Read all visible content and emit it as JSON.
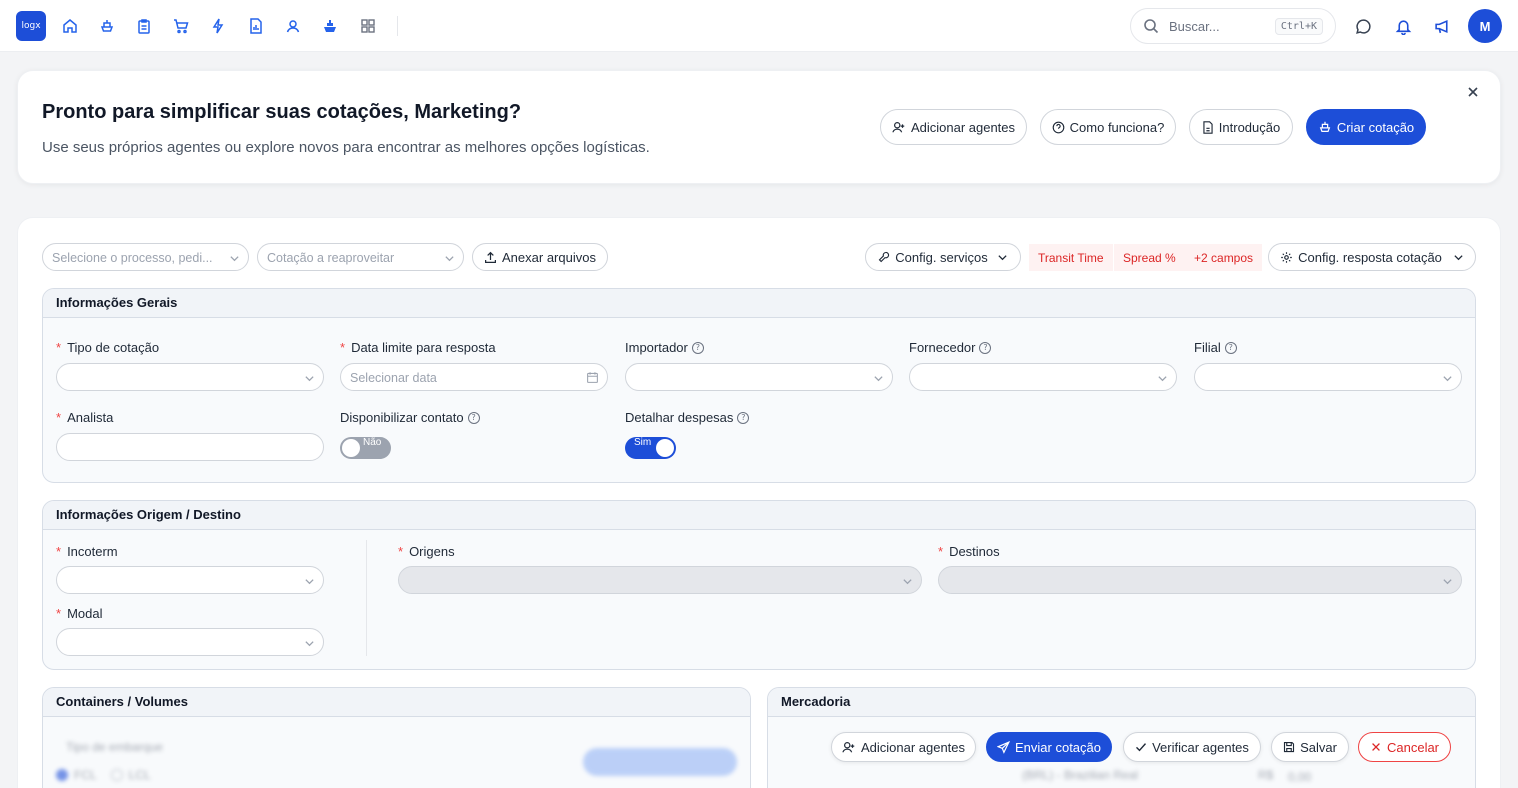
{
  "topbar": {
    "logo_text": "logx",
    "nav_icons": [
      "home-icon",
      "ship-icon",
      "clipboard-icon",
      "cart-icon",
      "bolt-icon",
      "document-chart-icon",
      "user-badge-icon",
      "vessel-icon",
      "grid-icon"
    ],
    "search_placeholder": "Buscar...",
    "search_shortcut": "Ctrl+K",
    "avatar_initial": "M"
  },
  "banner": {
    "title": "Pronto para simplificar suas cotações, Marketing?",
    "subtitle": "Use seus próprios agentes ou explore novos para encontrar as melhores opções logísticas.",
    "buttons": {
      "add_agents": "Adicionar agentes",
      "how_it_works": "Como funciona?",
      "intro": "Introdução",
      "create_quote": "Criar cotação"
    }
  },
  "toolbar": {
    "process_placeholder": "Selecione o processo, pedi...",
    "reuse_placeholder": "Cotação a reaproveitar",
    "attach_label": "Anexar arquivos",
    "config_services": "Config. serviços",
    "tags": [
      "Transit Time",
      "Spread %",
      "+2 campos"
    ],
    "config_response": "Config. resposta cotação"
  },
  "general": {
    "title": "Informações Gerais",
    "quote_type": "Tipo de cotação",
    "deadline": "Data limite para resposta",
    "deadline_placeholder": "Selecionar data",
    "importer": "Importador",
    "supplier": "Fornecedor",
    "branch": "Filial",
    "analyst": "Analista",
    "share_contact": "Disponibilizar contato",
    "share_contact_value": "Não",
    "detail_expenses": "Detalhar despesas",
    "detail_expenses_value": "Sim"
  },
  "origin_dest": {
    "title": "Informações Origem / Destino",
    "incoterm": "Incoterm",
    "modal": "Modal",
    "origins": "Origens",
    "destinations": "Destinos"
  },
  "containers": {
    "title": "Containers / Volumes",
    "load_type": "Tipo de embarque",
    "fcl": "FCL",
    "lcl": "LCL"
  },
  "goods": {
    "title": "Mercadoria",
    "currency": "(BRL) - Brazilian Real",
    "currency_symbol": "R$",
    "amount": "0,00"
  },
  "footer": {
    "add_agents": "Adicionar agentes",
    "send_quote": "Enviar cotação",
    "verify_agents": "Verificar agentes",
    "save": "Salvar",
    "cancel": "Cancelar"
  },
  "colors": {
    "primary": "#1d4ed8",
    "danger": "#dc2626"
  }
}
